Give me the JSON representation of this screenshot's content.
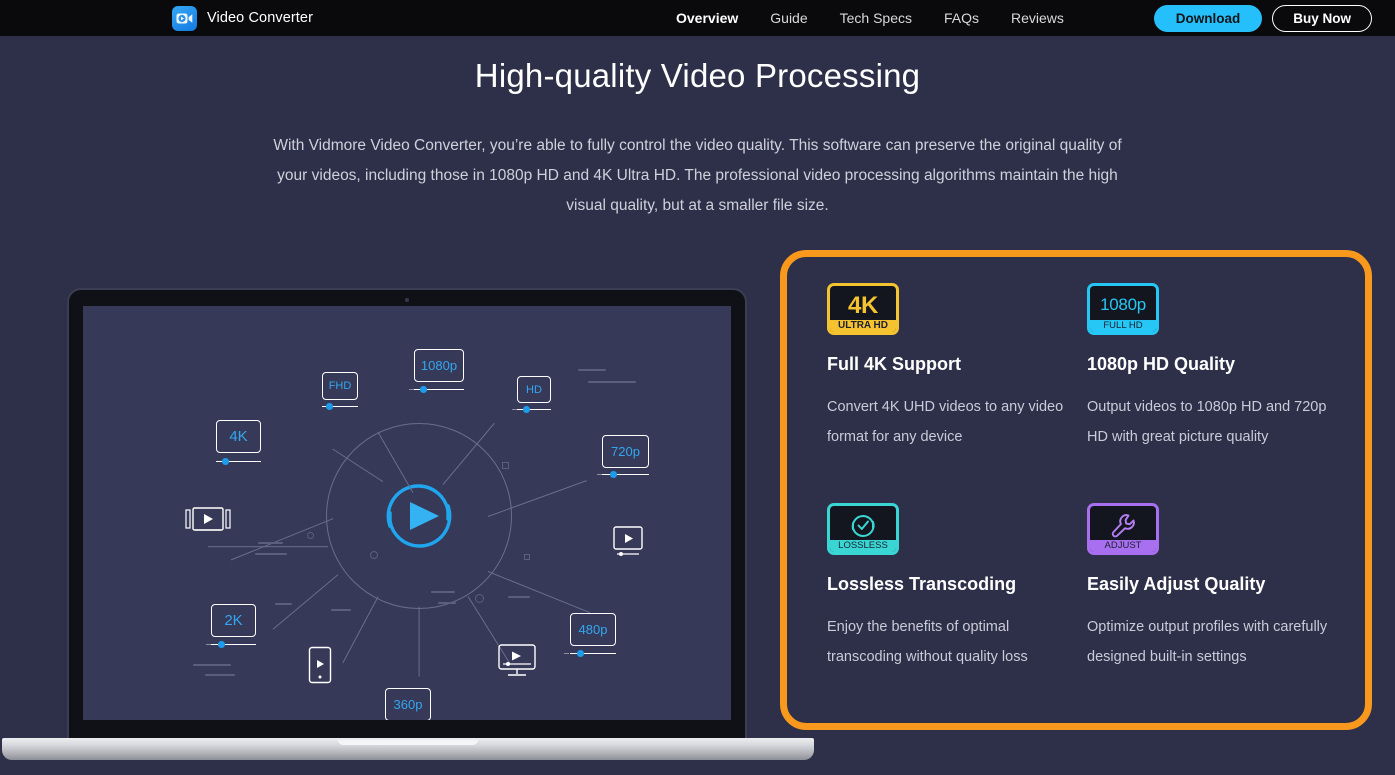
{
  "navbar": {
    "brand_name": "Video Converter",
    "brand_icon": "video-camera-icon",
    "links": [
      {
        "label": "Overview",
        "active": true
      },
      {
        "label": "Guide",
        "active": false
      },
      {
        "label": "Tech Specs",
        "active": false
      },
      {
        "label": "FAQs",
        "active": false
      },
      {
        "label": "Reviews",
        "active": false
      }
    ],
    "download_label": "Download",
    "buy_label": "Buy Now",
    "download_color": "#25c0fb",
    "background_color": "#0a0a0c"
  },
  "hero": {
    "title": "High-quality Video Processing",
    "description": "With Vidmore Video Converter, you’re able to fully control the video quality. This software can preserve the original quality of your videos, including those in 1080p HD and 4K Ultra HD. The professional video processing algorithms maintain the high visual quality, but at a smaller file size."
  },
  "illustration": {
    "device": "laptop",
    "center_icon": "refresh-play-icon",
    "resolution_chips": [
      {
        "label": "1080p"
      },
      {
        "label": "FHD"
      },
      {
        "label": "HD"
      },
      {
        "label": "4K"
      },
      {
        "label": "720p"
      },
      {
        "label": "2K"
      },
      {
        "label": "480p"
      },
      {
        "label": "360p"
      }
    ],
    "device_icons": [
      "film-strip-play-icon",
      "video-player-icon",
      "phone-play-icon",
      "monitor-play-icon"
    ]
  },
  "features": {
    "accent_color": "#f8991d",
    "items": [
      {
        "badge_main": "4K",
        "badge_sub": "ULTRA HD",
        "badge_color": "#f5c330",
        "icon_name": "4k-ultra-hd-badge-icon",
        "title": "Full 4K Support",
        "description": "Convert 4K UHD videos to any video format for any device"
      },
      {
        "badge_main": "1080p",
        "badge_sub": "FULL HD",
        "badge_color": "#26c6f5",
        "icon_name": "1080p-full-hd-badge-icon",
        "title": "1080p HD Quality",
        "description": "Output videos to 1080p HD and 720p HD with great picture quality"
      },
      {
        "badge_main": "",
        "badge_sub": "LOSSLESS",
        "badge_color": "#3ad6d3",
        "icon_name": "lossless-refresh-check-icon",
        "title": "Lossless Transcoding",
        "description": "Enjoy the benefits of optimal transcoding without quality loss"
      },
      {
        "badge_main": "",
        "badge_sub": "ADJUST",
        "badge_color": "#a86ff0",
        "icon_name": "adjust-wrench-icon",
        "title": "Easily Adjust Quality",
        "description": "Optimize output profiles with carefully designed built-in settings"
      }
    ]
  }
}
